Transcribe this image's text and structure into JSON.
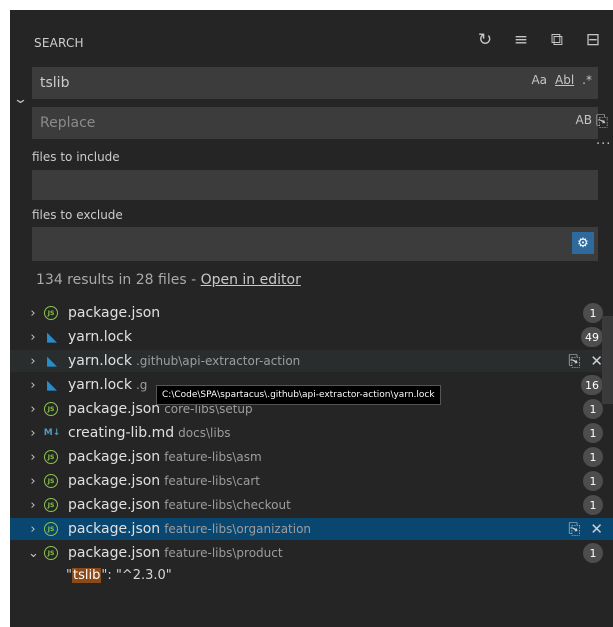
{
  "header": {
    "title": "SEARCH",
    "actions": [
      {
        "name": "refresh-icon",
        "glyph": "↻"
      },
      {
        "name": "clear-results-icon",
        "glyph": "≡"
      },
      {
        "name": "new-search-editor-icon",
        "glyph": "⧉"
      },
      {
        "name": "collapse-all-icon",
        "glyph": "⊟"
      }
    ]
  },
  "search": {
    "value": "tslib",
    "options": [
      "Aa",
      "Abl",
      ".*"
    ]
  },
  "replace": {
    "placeholder": "Replace",
    "preserve_case": "AB"
  },
  "include": {
    "label": "files to include",
    "value": ""
  },
  "exclude": {
    "label": "files to exclude",
    "value": ""
  },
  "summary": {
    "text": "134 results in 28 files - ",
    "link": "Open in editor"
  },
  "results": [
    {
      "name": "package.json",
      "path": "",
      "count": "1",
      "icon": "js"
    },
    {
      "name": "yarn.lock",
      "path": "",
      "count": "49",
      "icon": "yarn"
    },
    {
      "name": "yarn.lock",
      "path": ".github\\api-extractor-action",
      "count": "",
      "icon": "yarn",
      "state": "hover"
    },
    {
      "name": "yarn.lock",
      "path": ".g",
      "count": "16",
      "icon": "yarn"
    },
    {
      "name": "package.json",
      "path": "core-libs\\setup",
      "count": "1",
      "icon": "js"
    },
    {
      "name": "creating-lib.md",
      "path": "docs\\libs",
      "count": "1",
      "icon": "md"
    },
    {
      "name": "package.json",
      "path": "feature-libs\\asm",
      "count": "1",
      "icon": "js"
    },
    {
      "name": "package.json",
      "path": "feature-libs\\cart",
      "count": "1",
      "icon": "js"
    },
    {
      "name": "package.json",
      "path": "feature-libs\\checkout",
      "count": "1",
      "icon": "js"
    },
    {
      "name": "package.json",
      "path": "feature-libs\\organization",
      "count": "",
      "icon": "js",
      "state": "selected"
    },
    {
      "name": "package.json",
      "path": "feature-libs\\product",
      "count": "1",
      "icon": "js",
      "expanded": true
    }
  ],
  "match": {
    "quote_open": "\"",
    "highlight": "tslib",
    "rest": "\": \"^2.3.0\""
  },
  "tooltip": "C:\\Code\\SPA\\spartacus\\.github\\api-extractor-action\\yarn.lock",
  "colors": {
    "panel_bg": "#252526",
    "input_bg": "#3c3c3c",
    "selection": "#094771",
    "badge": "#4d4d4d",
    "match_highlight": "#8a4a1a"
  }
}
